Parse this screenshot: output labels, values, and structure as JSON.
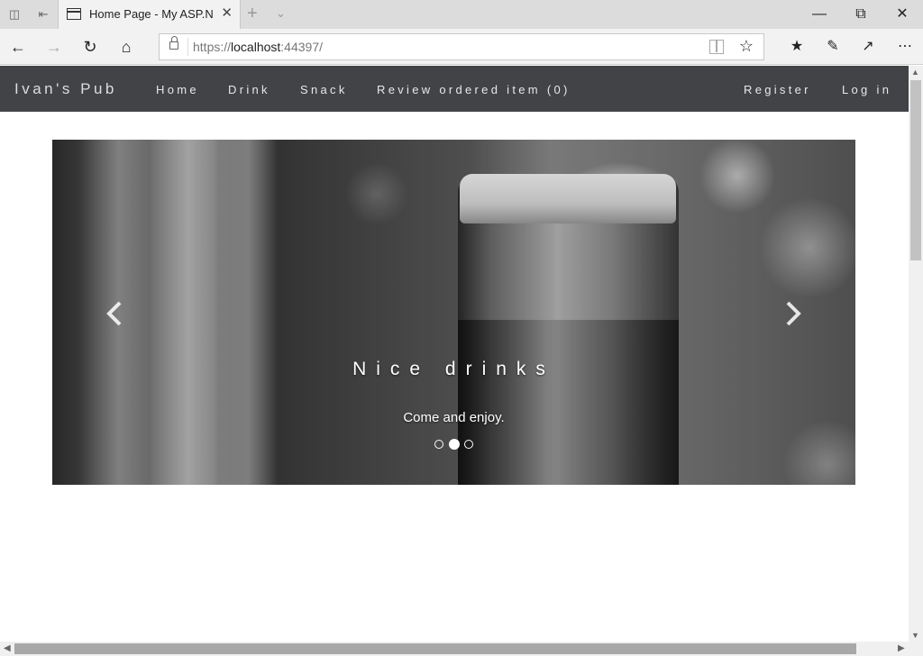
{
  "browser": {
    "tab_title": "Home Page - My ASP.N",
    "url_prefix": "https://",
    "url_host": "localhost",
    "url_rest": ":44397/"
  },
  "site": {
    "brand": "Ivan's Pub",
    "nav_left": [
      "Home",
      "Drink",
      "Snack",
      "Review ordered item (0)"
    ],
    "nav_right": [
      "Register",
      "Log in"
    ]
  },
  "carousel": {
    "caption_title": "Nice drinks",
    "caption_text": "Come and enjoy.",
    "slide_count": 3,
    "active_slide": 2
  }
}
